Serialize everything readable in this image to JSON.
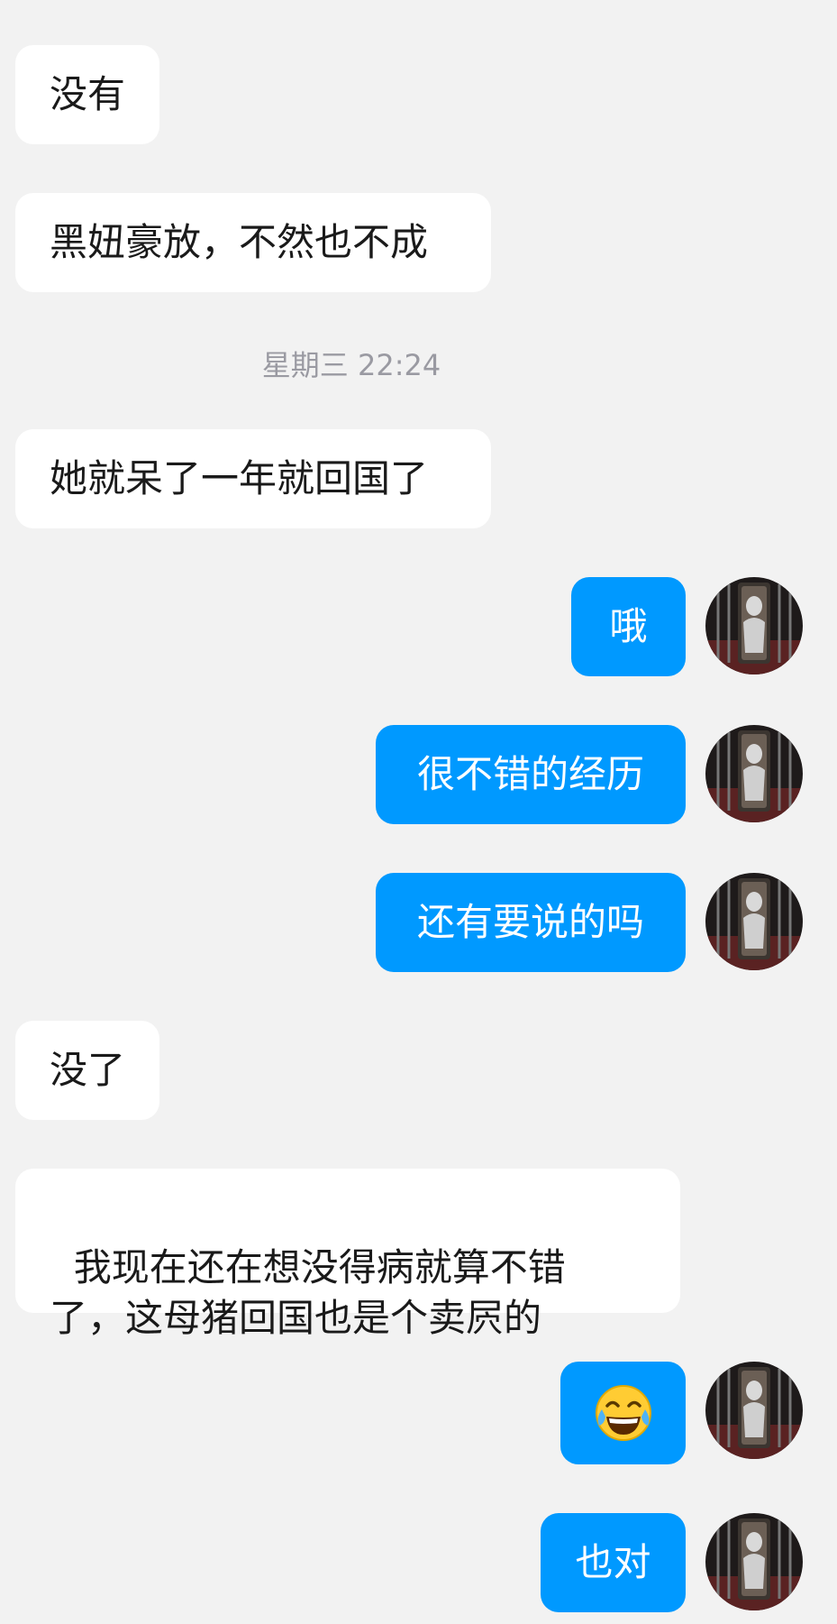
{
  "messages": {
    "m1": "没有",
    "m2": "黑妞豪放，不然也不成",
    "timestamp": "星期三 22:24",
    "m3": "她就呆了一年就回国了",
    "m4": "哦",
    "m5": "很不错的经历",
    "m6": "还有要说的吗",
    "m7": "没了",
    "m8": "我现在还在想没得病就算不错\n了，这母猪回国也是个卖屄的",
    "m9_emoji": "face-with-tears-of-joy-icon",
    "m10": "也对"
  },
  "colors": {
    "background": "#f2f2f2",
    "incoming_bubble": "#ffffff",
    "outgoing_bubble": "#0099ff",
    "outgoing_text": "#ffffff",
    "timestamp_text": "#9a9aa2"
  },
  "avatar_icon": "user-avatar-icon"
}
